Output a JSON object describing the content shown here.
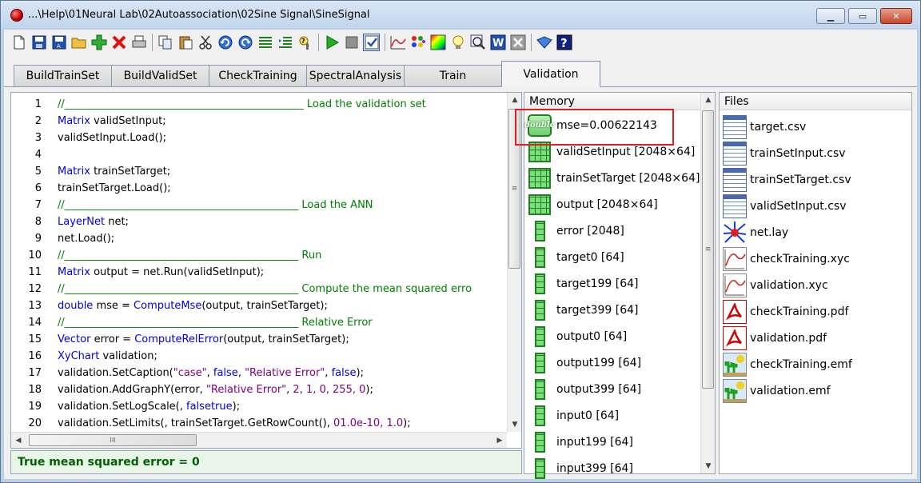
{
  "window": {
    "title": "...\\Help\\01Neural Lab\\02Autoassociation\\02Sine Signal\\SineSignal",
    "minimize": "▁",
    "restore": "▭",
    "close": "✕"
  },
  "toolbar": {
    "icons": [
      "new-icon",
      "save-icon",
      "save-as-icon",
      "open-folder-icon",
      "add-icon",
      "delete-icon",
      "print-icon",
      "copy-icon",
      "paste-icon",
      "cut-icon",
      "undo-icon",
      "redo-icon",
      "align-icon",
      "indent-icon",
      "help-search-icon",
      "run-icon",
      "stop-icon",
      "check-icon",
      "chart-icon",
      "palette-icon",
      "color-icon",
      "bulb-icon",
      "zoom-icon",
      "word-icon",
      "excel-icon",
      "book-icon",
      "help-icon"
    ]
  },
  "tabs": [
    {
      "label": "BuildTrainSet"
    },
    {
      "label": "BuildValidSet"
    },
    {
      "label": "CheckTraining"
    },
    {
      "label": "SpectralAnalysis"
    },
    {
      "label": "Train"
    },
    {
      "label": "Validation"
    }
  ],
  "editor": {
    "lines": [
      {
        "n": "1",
        "comment": "//______________________________________________  Load the validation set"
      },
      {
        "n": "2",
        "kw": "Matrix",
        "rest": " validSetInput;"
      },
      {
        "n": "3",
        "rest": "validSetInput.Load();"
      },
      {
        "n": "4",
        "rest": ""
      },
      {
        "n": "5",
        "kw": "Matrix",
        "rest": " trainSetTarget;"
      },
      {
        "n": "6",
        "rest": "trainSetTarget.Load();"
      },
      {
        "n": "7",
        "comment": "//_____________________________________________ Load the ANN"
      },
      {
        "n": "8",
        "kw": "LayerNet",
        "rest": " net;"
      },
      {
        "n": "9",
        "rest": "net.Load();"
      },
      {
        "n": "10",
        "comment": "//_____________________________________________ Run"
      },
      {
        "n": "11",
        "kw": "Matrix",
        "rest": " output = net.Run(validSetInput);"
      },
      {
        "n": "12",
        "comment": "//_____________________________________________ Compute the mean squared erro"
      },
      {
        "n": "13",
        "kw": "double",
        "rest": " mse = ",
        "fn": "ComputeMse",
        "rest2": "(output, trainSetTarget);"
      },
      {
        "n": "14",
        "comment": "//_____________________________________________ Relative Error"
      },
      {
        "n": "15",
        "kw": "Vector",
        "rest": " error = ",
        "fn": "ComputeRelError",
        "rest2": "(output, trainSetTarget);"
      },
      {
        "n": "16",
        "kw": "XyChart",
        "rest": " validation;"
      },
      {
        "n": "17",
        "rest": "validation.SetCaption(",
        "s1": "\"case\"",
        "c1": ", ",
        "k1": "false",
        "c2": ", ",
        "s2": "\"Relative Error\"",
        "c3": ", ",
        "k2": "false",
        "c4": ");"
      },
      {
        "n": "18",
        "rest": "validation.AddGraphY(error, ",
        "s1": "\"Relative Error\"",
        "c1": ", ",
        "k1": "2, 1, 0, 255, 0",
        "c4": ");"
      },
      {
        "n": "19",
        "rest": "validation.SetLogScale(",
        "k1": "false",
        "c1": ", ",
        "k2": "true",
        "c4": ");"
      },
      {
        "n": "20",
        "rest": "validation.SetLimits(",
        "k1": "0",
        "c1": ", trainSetTarget.GetRowCount(), ",
        "k2": "1.0e-10, 1.0",
        "c4": ");"
      }
    ]
  },
  "status": {
    "text": "True mean squared error = 0"
  },
  "memory": {
    "header": "Memory",
    "items": [
      {
        "label": "mse=0.00622143",
        "icon": "double-icon",
        "icon_text": "double"
      },
      {
        "label": "validSetInput [2048×64]",
        "icon": "matrix-icon"
      },
      {
        "label": "trainSetTarget [2048×64]",
        "icon": "matrix-icon"
      },
      {
        "label": "output [2048×64]",
        "icon": "matrix-icon"
      },
      {
        "label": "error [2048]",
        "icon": "vector-icon"
      },
      {
        "label": "target0 [64]",
        "icon": "vector-icon"
      },
      {
        "label": "target199 [64]",
        "icon": "vector-icon"
      },
      {
        "label": "target399 [64]",
        "icon": "vector-icon"
      },
      {
        "label": "output0 [64]",
        "icon": "vector-icon"
      },
      {
        "label": "output199 [64]",
        "icon": "vector-icon"
      },
      {
        "label": "output399 [64]",
        "icon": "vector-icon"
      },
      {
        "label": "input0 [64]",
        "icon": "vector-icon"
      },
      {
        "label": "input199 [64]",
        "icon": "vector-icon"
      },
      {
        "label": "input399 [64]",
        "icon": "vector-icon"
      }
    ]
  },
  "files": {
    "header": "Files",
    "items": [
      {
        "label": "target.csv",
        "icon": "csv-icon"
      },
      {
        "label": "trainSetInput.csv",
        "icon": "csv-icon"
      },
      {
        "label": "trainSetTarget.csv",
        "icon": "csv-icon"
      },
      {
        "label": "validSetInput.csv",
        "icon": "csv-icon"
      },
      {
        "label": "net.lay",
        "icon": "lay-icon"
      },
      {
        "label": "checkTraining.xyc",
        "icon": "xyc-icon"
      },
      {
        "label": "validation.xyc",
        "icon": "xyc-icon"
      },
      {
        "label": "checkTraining.pdf",
        "icon": "pdf-icon"
      },
      {
        "label": "validation.pdf",
        "icon": "pdf-icon"
      },
      {
        "label": "checkTraining.emf",
        "icon": "emf-icon"
      },
      {
        "label": "validation.emf",
        "icon": "emf-icon"
      }
    ]
  },
  "scroll": {
    "up": "▲",
    "down": "▼",
    "left": "◀",
    "right": "▶",
    "grip": "≡",
    "hgrip": "III"
  }
}
